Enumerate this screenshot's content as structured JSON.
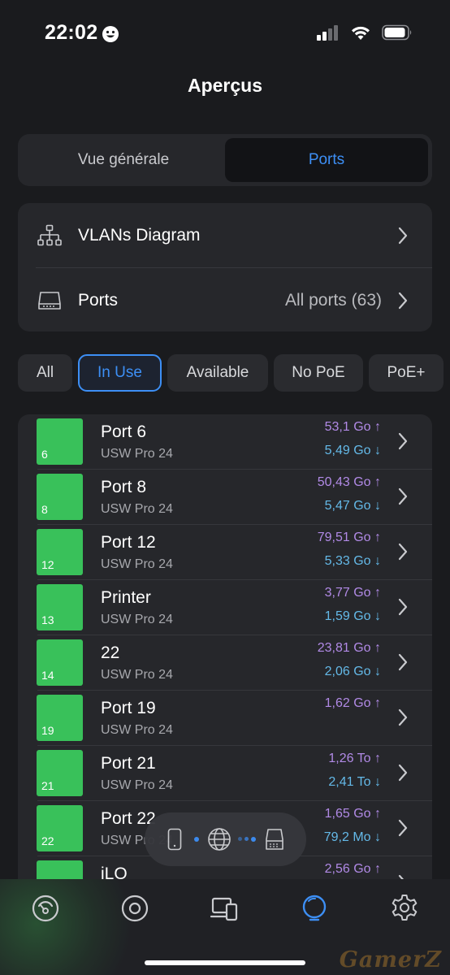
{
  "status": {
    "time": "22:02"
  },
  "header": {
    "title": "Aperçus"
  },
  "segments": [
    {
      "label": "Vue générale"
    },
    {
      "label": "Ports"
    }
  ],
  "nav": {
    "vlans_label": "VLANs Diagram",
    "ports_label": "Ports",
    "ports_value": "All ports (63)"
  },
  "filters": [
    {
      "label": "All"
    },
    {
      "label": "In Use"
    },
    {
      "label": "Available"
    },
    {
      "label": "No PoE"
    },
    {
      "label": "PoE+"
    }
  ],
  "ports": [
    {
      "num": "6",
      "name": "Port 6",
      "device": "USW Pro 24",
      "up": "53,1 Go ↑",
      "down": "5,49 Go ↓"
    },
    {
      "num": "8",
      "name": "Port 8",
      "device": "USW Pro 24",
      "up": "50,43 Go ↑",
      "down": "5,47 Go ↓"
    },
    {
      "num": "12",
      "name": "Port 12",
      "device": "USW Pro 24",
      "up": "79,51 Go ↑",
      "down": "5,33 Go ↓"
    },
    {
      "num": "13",
      "name": "Printer",
      "device": "USW Pro 24",
      "up": "3,77 Go ↑",
      "down": "1,59 Go ↓"
    },
    {
      "num": "14",
      "name": "22",
      "device": "USW Pro 24",
      "up": "23,81 Go ↑",
      "down": "2,06 Go ↓"
    },
    {
      "num": "19",
      "name": "Port 19",
      "device": "USW Pro 24",
      "up": "1,62 Go ↑",
      "down": ""
    },
    {
      "num": "21",
      "name": "Port 21",
      "device": "USW Pro 24",
      "up": "1,26 To ↑",
      "down": "2,41 To ↓"
    },
    {
      "num": "22",
      "name": "Port 22",
      "device": "USW Pro 24",
      "up": "1,65 Go ↑",
      "down": "79,2 Mo ↓"
    },
    {
      "num": "",
      "name": "iLO",
      "device": "",
      "up": "2,56 Go ↑",
      "down": ""
    }
  ],
  "tabbar": {
    "items": [
      {
        "icon": "dashboard-icon"
      },
      {
        "icon": "target-icon"
      },
      {
        "icon": "devices-icon"
      },
      {
        "icon": "insights-icon"
      },
      {
        "icon": "settings-icon"
      }
    ]
  },
  "colors": {
    "accent": "#3d8ff5",
    "port_active": "#39c15a",
    "upload": "#b18ae6",
    "download": "#64b9e8"
  },
  "watermark": "GamerZ"
}
